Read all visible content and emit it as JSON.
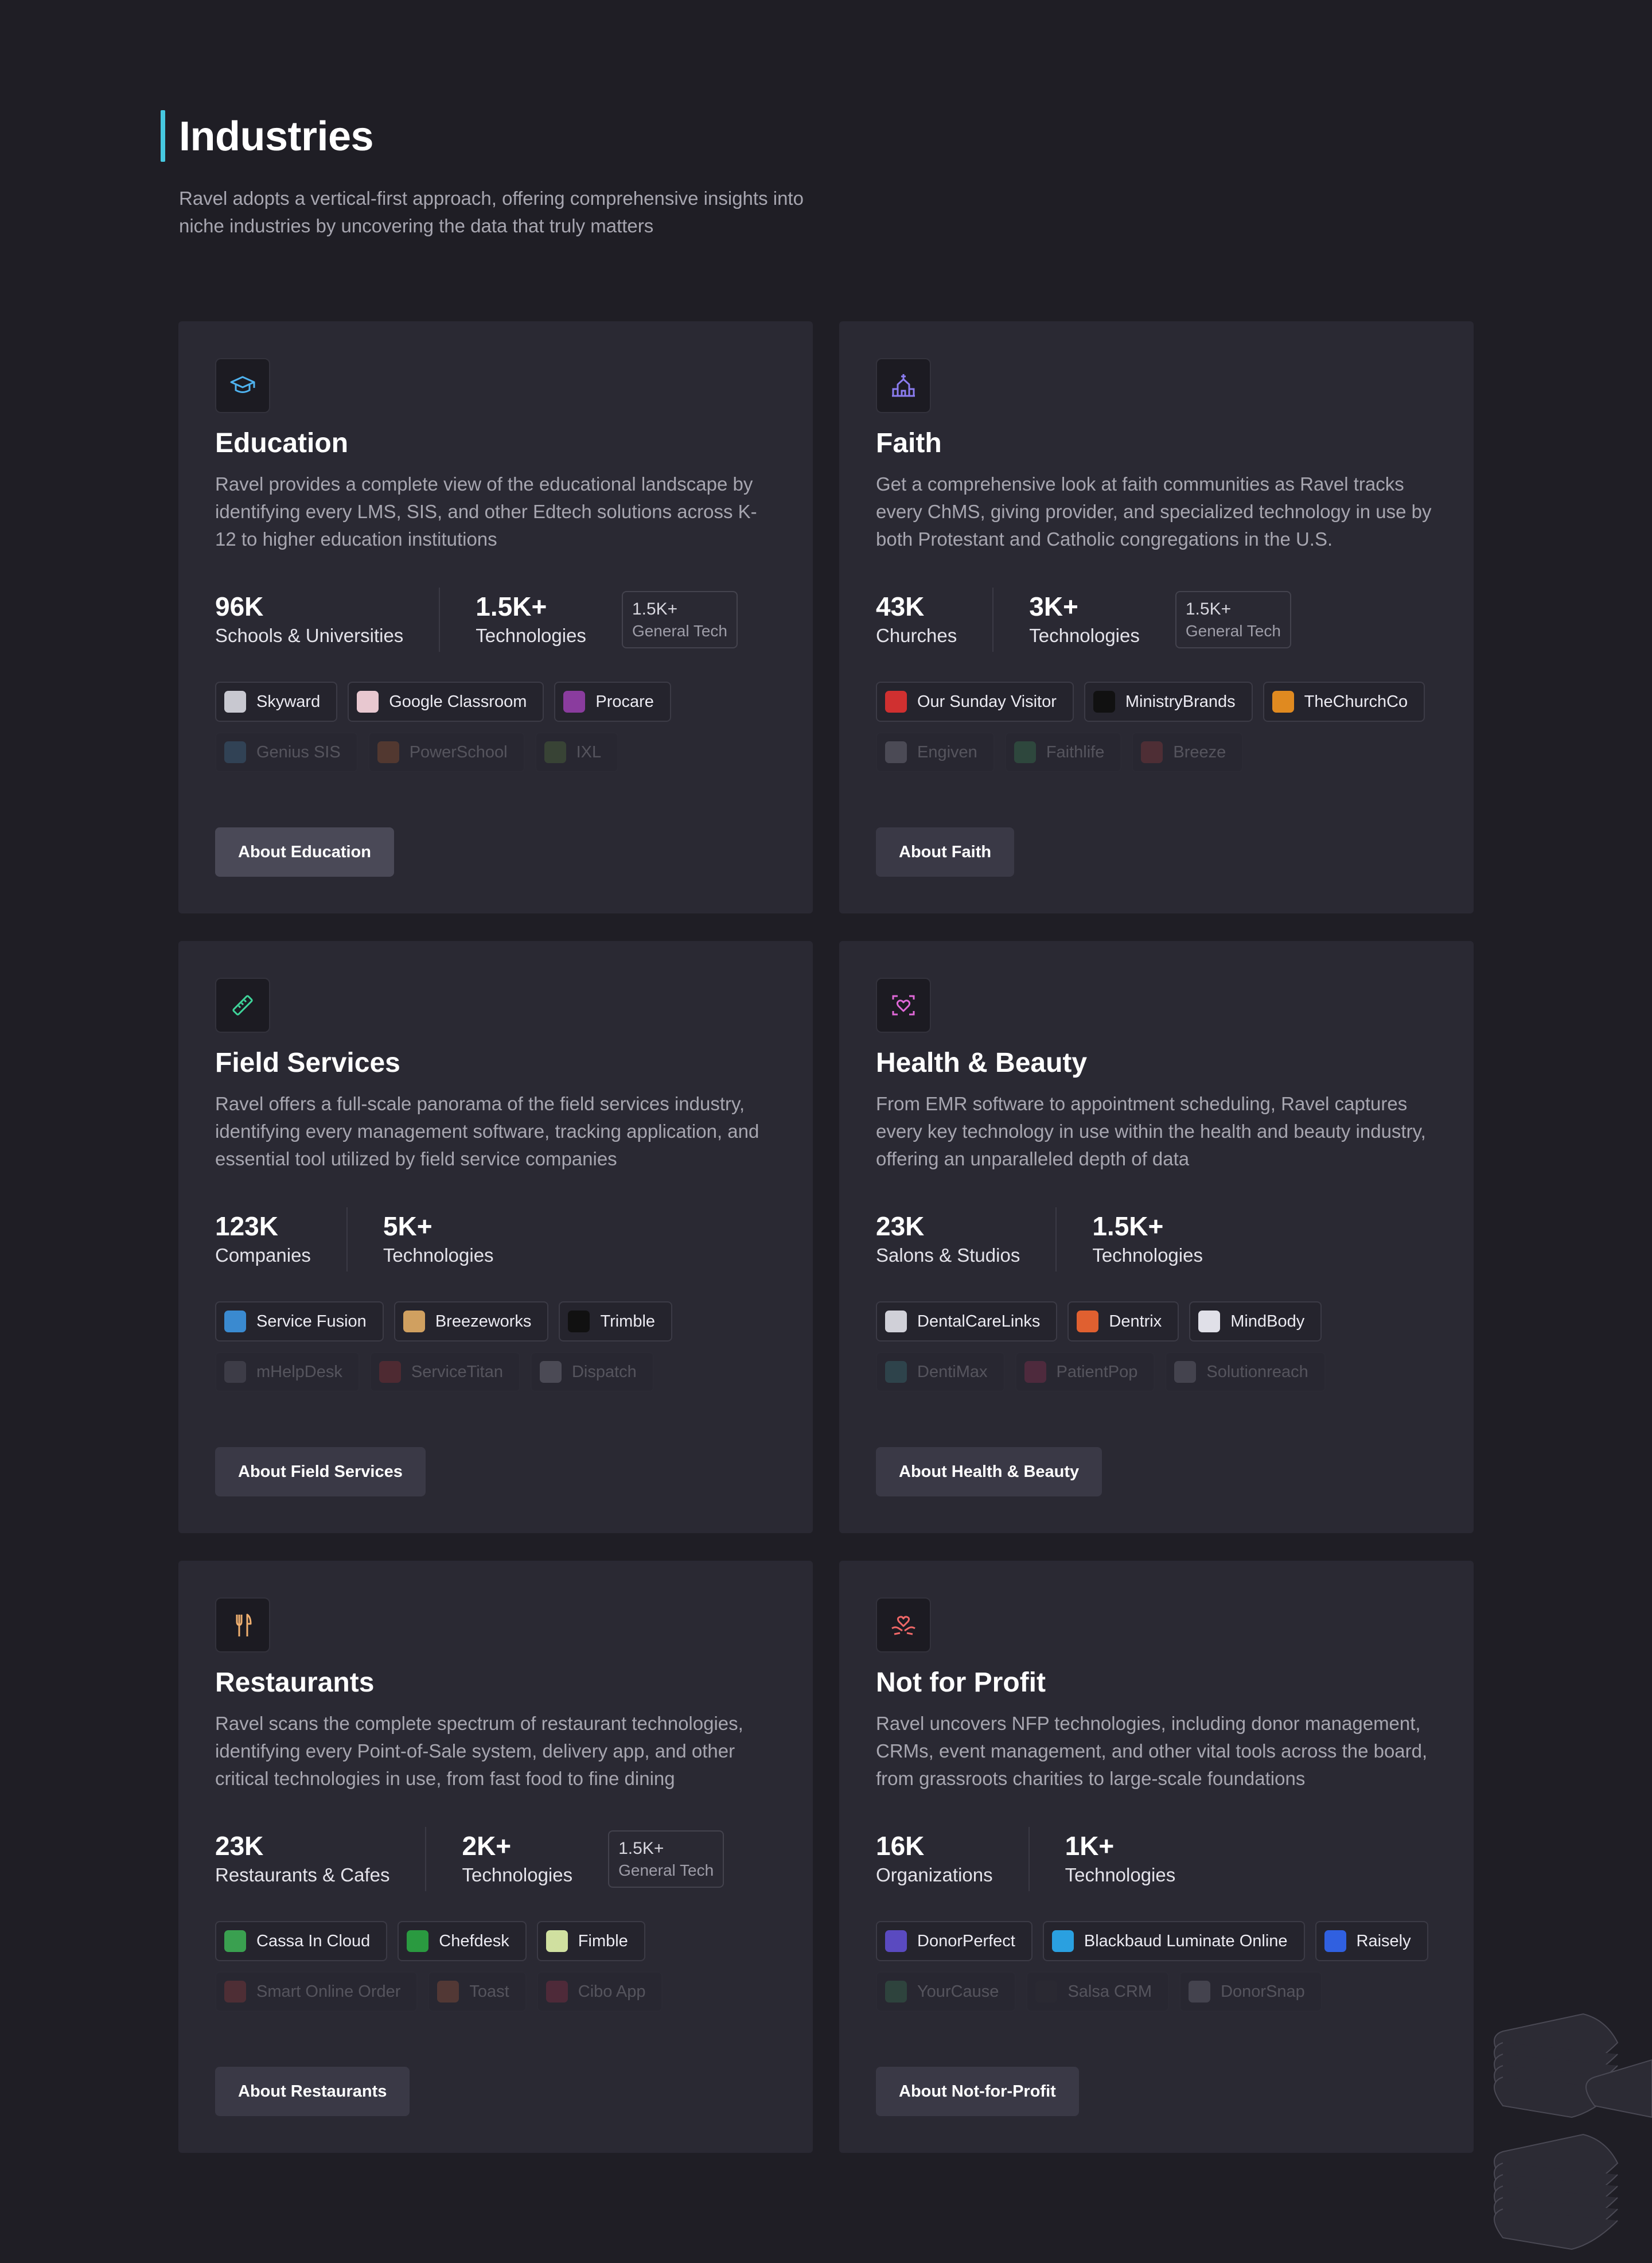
{
  "header": {
    "title": "Industries",
    "subtitle": "Ravel adopts a vertical-first approach, offering comprehensive insights into niche industries by uncovering the data that truly matters"
  },
  "colors": {
    "accent": "#46c8e0",
    "background": "#1f1e25",
    "card": "#2a2933"
  },
  "cards": [
    {
      "icon": "graduation-cap-icon",
      "icon_color": "#4fb3f0",
      "title": "Education",
      "description": "Ravel provides a complete view of the educational landscape by identifying every LMS, SIS, and other Edtech solutions across K-12 to higher education institutions",
      "stat1": {
        "value": "96K",
        "label": "Schools & Universities"
      },
      "stat2": {
        "value": "1.5K+",
        "label": "Technologies"
      },
      "general_tech": {
        "value": "1.5K+",
        "label": "General Tech"
      },
      "tools": [
        {
          "name": "Skyward",
          "color": "#c8c8d0"
        },
        {
          "name": "Google Classroom",
          "color": "#e8c8d0"
        },
        {
          "name": "Procare",
          "color": "#8a3c9e"
        }
      ],
      "faded_tools": [
        {
          "name": "Genius SIS",
          "color": "#4a9ad0"
        },
        {
          "name": "PowerSchool",
          "color": "#e0702a"
        },
        {
          "name": "IXL",
          "color": "#6aa040"
        }
      ],
      "button": "About Education"
    },
    {
      "icon": "church-icon",
      "icon_color": "#8b7cf0",
      "title": "Faith",
      "description": "Get a comprehensive look at faith communities as Ravel tracks every ChMS, giving provider, and specialized technology in use by both Protestant and Catholic congregations in the U.S.",
      "stat1": {
        "value": "43K",
        "label": "Churches"
      },
      "stat2": {
        "value": "3K+",
        "label": "Technologies"
      },
      "general_tech": {
        "value": "1.5K+",
        "label": "General Tech"
      },
      "tools": [
        {
          "name": "Our Sunday Visitor",
          "color": "#d03030"
        },
        {
          "name": "MinistryBrands",
          "color": "#111111"
        },
        {
          "name": "TheChurchCo",
          "color": "#e08a20"
        }
      ],
      "faded_tools": [
        {
          "name": "Engiven",
          "color": "#c0c0d0"
        },
        {
          "name": "Faithlife",
          "color": "#40b060"
        },
        {
          "name": "Breeze",
          "color": "#d04040"
        }
      ],
      "button": "About Faith"
    },
    {
      "icon": "ruler-icon",
      "icon_color": "#3fd49a",
      "title": "Field Services",
      "description": "Ravel offers a full-scale panorama of the field services industry, identifying every management software, tracking application, and essential tool utilized by field service companies",
      "stat1": {
        "value": "123K",
        "label": "Companies"
      },
      "stat2": {
        "value": "5K+",
        "label": "Technologies"
      },
      "tools": [
        {
          "name": "Service Fusion",
          "color": "#3a8ad0"
        },
        {
          "name": "Breezeworks",
          "color": "#d0a060"
        },
        {
          "name": "Trimble",
          "color": "#111111"
        }
      ],
      "faded_tools": [
        {
          "name": "mHelpDesk",
          "color": "#808090"
        },
        {
          "name": "ServiceTitan",
          "color": "#d03030"
        },
        {
          "name": "Dispatch",
          "color": "#c0c0d0"
        }
      ],
      "button": "About Field Services"
    },
    {
      "icon": "face-scan-heart-icon",
      "icon_color": "#e068d8",
      "title": "Health & Beauty",
      "description": "From EMR software to appointment scheduling, Ravel captures every key technology in use within the health and beauty industry, offering an unparalleled depth of data",
      "stat1": {
        "value": "23K",
        "label": "Salons & Studios"
      },
      "stat2": {
        "value": "1.5K+",
        "label": "Technologies"
      },
      "tools": [
        {
          "name": "DentalCareLinks",
          "color": "#d0d0d8"
        },
        {
          "name": "Dentrix",
          "color": "#e06030"
        },
        {
          "name": "MindBody",
          "color": "#e0e0e8"
        }
      ],
      "faded_tools": [
        {
          "name": "DentiMax",
          "color": "#40a0a0"
        },
        {
          "name": "PatientPop",
          "color": "#d03060"
        },
        {
          "name": "Solutionreach",
          "color": "#a0a0b0"
        }
      ],
      "button": "About Health & Beauty"
    },
    {
      "icon": "fork-knife-icon",
      "icon_color": "#f0b070",
      "title": "Restaurants",
      "description": "Ravel scans the complete spectrum of restaurant technologies, identifying every Point-of-Sale system, delivery app, and other critical technologies in use, from fast food to fine dining",
      "stat1": {
        "value": "23K",
        "label": "Restaurants & Cafes"
      },
      "stat2": {
        "value": "2K+",
        "label": "Technologies"
      },
      "general_tech": {
        "value": "1.5K+",
        "label": "General Tech"
      },
      "tools": [
        {
          "name": "Cassa In Cloud",
          "color": "#3aa050"
        },
        {
          "name": "Chefdesk",
          "color": "#2a9a40"
        },
        {
          "name": "Fimble",
          "color": "#d0e0a0"
        }
      ],
      "faded_tools": [
        {
          "name": "Smart Online Order",
          "color": "#d04040"
        },
        {
          "name": "Toast",
          "color": "#e07040"
        },
        {
          "name": "Cibo App",
          "color": "#d03050"
        }
      ],
      "button": "About Restaurants"
    },
    {
      "icon": "hand-heart-icon",
      "icon_color": "#f06868",
      "title": "Not for Profit",
      "description": "Ravel uncovers NFP technologies, including donor management, CRMs, event management, and other vital tools across the board, from grassroots charities to large-scale foundations",
      "stat1": {
        "value": "16K",
        "label": "Organizations"
      },
      "stat2": {
        "value": "1K+",
        "label": "Technologies"
      },
      "tools": [
        {
          "name": "DonorPerfect",
          "color": "#5a4ac0"
        },
        {
          "name": "Blackbaud Luminate Online",
          "color": "#2aa0e0"
        },
        {
          "name": "Raisely",
          "color": "#3060e0"
        }
      ],
      "faded_tools": [
        {
          "name": "YourCause",
          "color": "#40a060"
        },
        {
          "name": "Salsa CRM",
          "color": "#2a2a30"
        },
        {
          "name": "DonorSnap",
          "color": "#a0a0b0"
        }
      ],
      "button": "About Not-for-Profit"
    }
  ]
}
